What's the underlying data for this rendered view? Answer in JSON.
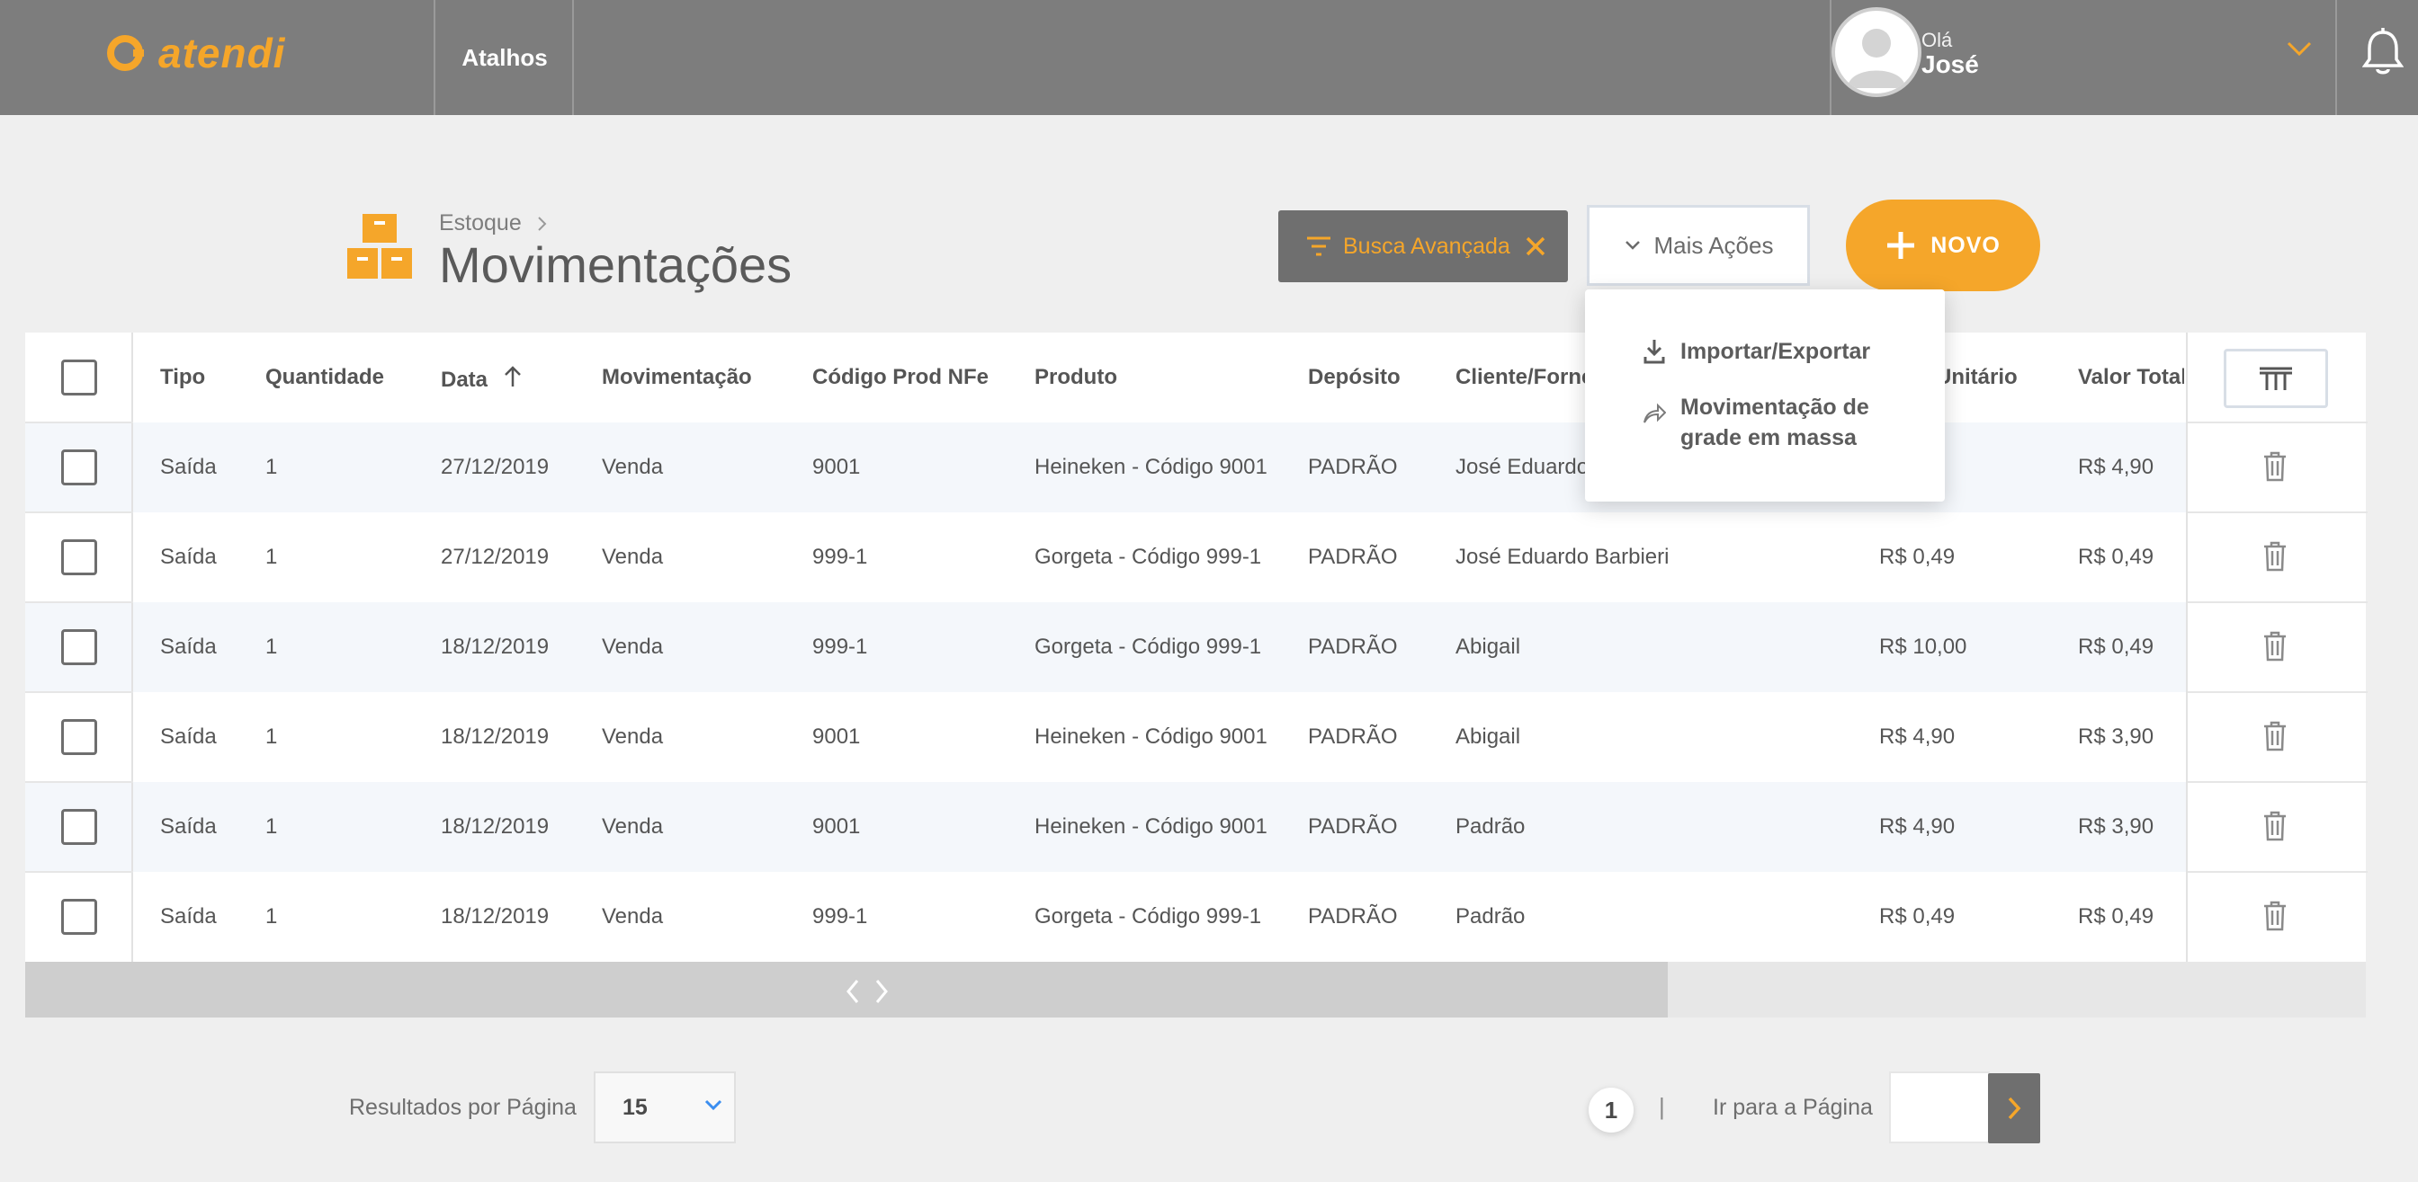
{
  "app": {
    "logo_text": "atendi",
    "shortcuts_label": "Atalhos",
    "greeting": "Olá",
    "user_name": "José",
    "brand_color": "#f5a62a",
    "topbar_color": "#7d7d7d"
  },
  "page": {
    "breadcrumb": "Estoque",
    "title": "Movimentações",
    "icon": "boxes-icon"
  },
  "toolbar": {
    "advanced_search_label": "Busca Avançada",
    "more_actions_label": "Mais Ações",
    "new_label": "NOVO"
  },
  "dropdown": {
    "items": [
      {
        "label": "Importar/Exportar",
        "icon": "download-icon"
      },
      {
        "label": "Movimentação de grade em massa",
        "label_line1": "Movimentação de",
        "label_line2": "grade em massa",
        "icon": "share-icon"
      }
    ]
  },
  "table": {
    "headers": [
      "Tipo",
      "Quantidade",
      "Data",
      "Movimentação",
      "Código Prod NFe",
      "Produto",
      "Depósito",
      "Cliente/Forne",
      "Unitário",
      "Valor Total"
    ],
    "sorted_column": "Data",
    "rows": [
      {
        "tipo": "Saída",
        "quantidade": "1",
        "data": "27/12/2019",
        "movimentacao": "Venda",
        "codigo": "9001",
        "produto": "Heineken - Código 9001",
        "deposito": "PADRÃO",
        "cliente": "José Eduardo B",
        "unitario": "",
        "total": "R$  4,90"
      },
      {
        "tipo": "Saída",
        "quantidade": "1",
        "data": "27/12/2019",
        "movimentacao": "Venda",
        "codigo": "999-1",
        "produto": "Gorgeta - Código 999-1",
        "deposito": "PADRÃO",
        "cliente": "José Eduardo Barbieri",
        "unitario": "R$ 0,49",
        "total": "R$  0,49"
      },
      {
        "tipo": "Saída",
        "quantidade": "1",
        "data": "18/12/2019",
        "movimentacao": "Venda",
        "codigo": "999-1",
        "produto": "Gorgeta - Código 999-1",
        "deposito": "PADRÃO",
        "cliente": "Abigail",
        "unitario": "R$ 10,00",
        "total": "R$  0,49"
      },
      {
        "tipo": "Saída",
        "quantidade": "1",
        "data": "18/12/2019",
        "movimentacao": "Venda",
        "codigo": "9001",
        "produto": "Heineken - Código 9001",
        "deposito": "PADRÃO",
        "cliente": "Abigail",
        "unitario": "R$ 4,90",
        "total": "R$  3,90"
      },
      {
        "tipo": "Saída",
        "quantidade": "1",
        "data": "18/12/2019",
        "movimentacao": "Venda",
        "codigo": "9001",
        "produto": "Heineken - Código 9001",
        "deposito": "PADRÃO",
        "cliente": "Padrão",
        "unitario": "R$ 4,90",
        "total": "R$  3,90"
      },
      {
        "tipo": "Saída",
        "quantidade": "1",
        "data": "18/12/2019",
        "movimentacao": "Venda",
        "codigo": "999-1",
        "produto": "Gorgeta - Código 999-1",
        "deposito": "PADRÃO",
        "cliente": "Padrão",
        "unitario": "R$ 0,49",
        "total": "R$  0,49"
      }
    ]
  },
  "pagination": {
    "per_page_label": "Resultados por Página",
    "per_page_value": "15",
    "current_page": "1",
    "separator": "|",
    "goto_label": "Ir para a Página"
  }
}
